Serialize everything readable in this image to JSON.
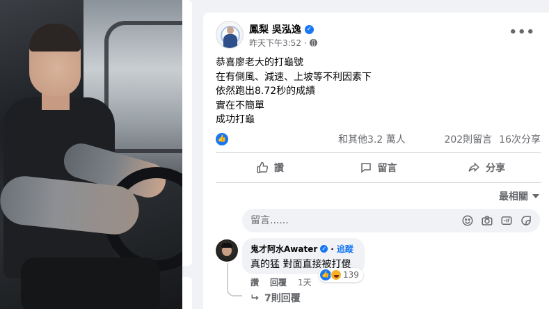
{
  "post": {
    "author": "鳳梨 吳泓逸",
    "timestamp": "昨天下午3:52",
    "lines": [
      "恭喜廖老大的打龜號",
      "在有側風、減速、上坡等不利因素下",
      "依然跑出8.72秒的成績",
      "實在不簡單",
      "成功打龜"
    ],
    "reactions_text": "和其他3.2 萬人",
    "comments_count": "202則留言",
    "shares_count": "16次分享"
  },
  "actions": {
    "like": "讚",
    "comment": "留言",
    "share": "分享"
  },
  "sort_label": "最相關",
  "comment_box": {
    "placeholder": "留言......"
  },
  "comment": {
    "name": "鬼才阿水Awater",
    "follow": "追蹤",
    "text": "真的猛 對面直接被打傻",
    "reaction_count": "139",
    "like_label": "讚",
    "reply_label": "回覆",
    "time": "1天",
    "replies_label": "7則回覆"
  },
  "colors": {
    "accent": "#1877f2",
    "secondary_text": "#65676b",
    "background": "#f0f2f5"
  },
  "icons": [
    "more-icon",
    "globe-icon",
    "verified-icon",
    "like-icon",
    "comment-icon",
    "share-icon",
    "emoji-icon",
    "camera-icon",
    "gif-icon",
    "sticker-icon",
    "haha-icon",
    "reply-arrow-icon"
  ]
}
